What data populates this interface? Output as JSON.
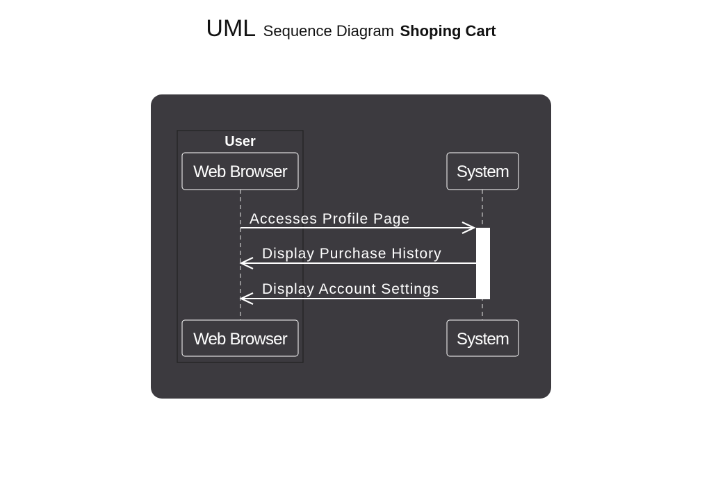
{
  "title": {
    "main": "UML",
    "subtitle": "Sequence Diagram",
    "name": "Shoping Cart"
  },
  "colors": {
    "panel": "#3c3a3f",
    "foreground": "#ffffff",
    "group_border": "#222222"
  },
  "group": {
    "label": "User"
  },
  "participants": [
    {
      "id": "browser",
      "label": "Web Browser"
    },
    {
      "id": "system",
      "label": "System"
    }
  ],
  "messages": [
    {
      "from": "browser",
      "to": "system",
      "label": "Accesses Profile Page"
    },
    {
      "from": "system",
      "to": "browser",
      "label": "Display Purchase History"
    },
    {
      "from": "system",
      "to": "browser",
      "label": "Display Account Settings"
    }
  ]
}
